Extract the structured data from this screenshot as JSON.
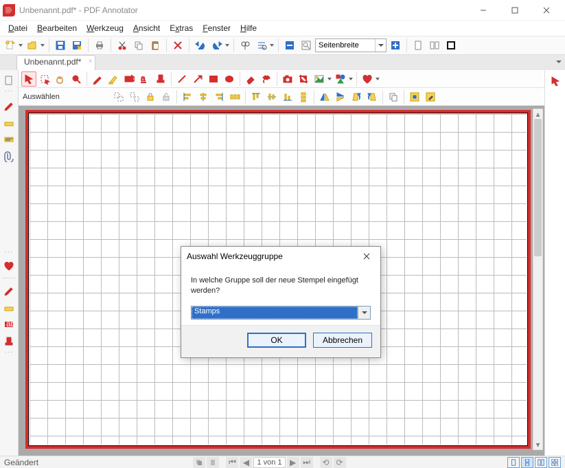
{
  "window": {
    "title": "Unbenannt.pdf* - PDF Annotator"
  },
  "menu": {
    "items": [
      {
        "pre": "",
        "hot": "D",
        "post": "atei"
      },
      {
        "pre": "",
        "hot": "B",
        "post": "earbeiten"
      },
      {
        "pre": "",
        "hot": "W",
        "post": "erkzeug"
      },
      {
        "pre": "",
        "hot": "A",
        "post": "nsicht"
      },
      {
        "pre": "E",
        "hot": "x",
        "post": "tras"
      },
      {
        "pre": "",
        "hot": "F",
        "post": "enster"
      },
      {
        "pre": "",
        "hot": "H",
        "post": "ilfe"
      }
    ]
  },
  "toolbar": {
    "zoom_value": "Seitenbreite"
  },
  "tabs": {
    "active": "Unbenannt.pdf*"
  },
  "tool_label": "Auswählen",
  "status": {
    "left": "Geändert",
    "page_field": "1 von 1"
  },
  "dialog": {
    "title": "Auswahl Werkzeuggruppe",
    "text": "In welche Gruppe soll der neue Stempel eingefügt werden?",
    "selected": "Stamps",
    "ok": "OK",
    "cancel": "Abbrechen"
  }
}
